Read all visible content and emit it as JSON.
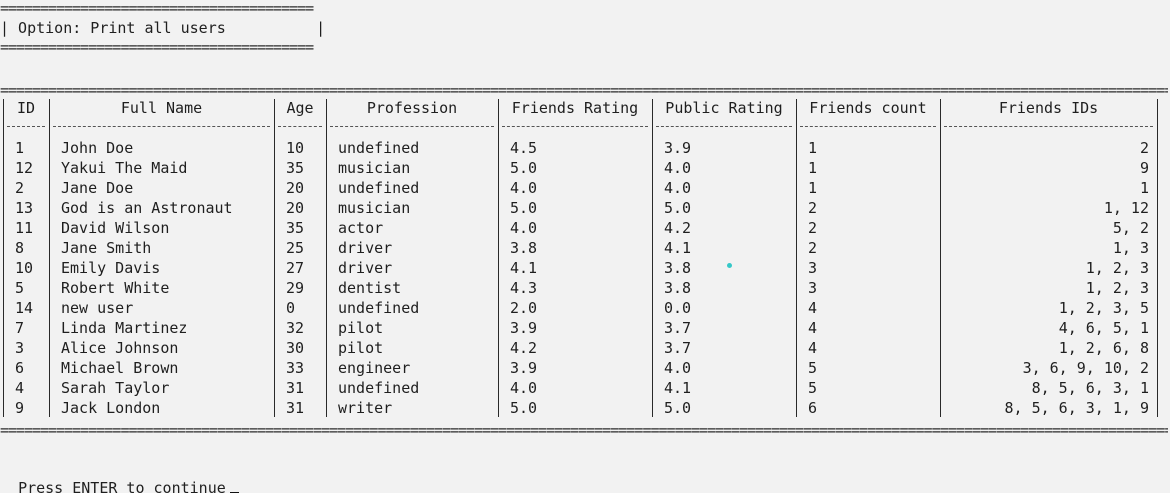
{
  "option_box": {
    "title": "| Option: Print all users          |",
    "rule": "======================================="
  },
  "table": {
    "columns": [
      "ID",
      "Full Name",
      "Age",
      "Profession",
      "Friends Rating",
      "Public Rating",
      "Friends count",
      "Friends IDs"
    ],
    "rows": [
      [
        "1",
        "John Doe",
        "10",
        "undefined",
        "4.5",
        "3.9",
        "1",
        "2"
      ],
      [
        "12",
        "Yakui The Maid",
        "35",
        "musician",
        "5.0",
        "4.0",
        "1",
        "9"
      ],
      [
        "2",
        "Jane Doe",
        "20",
        "undefined",
        "4.0",
        "4.0",
        "1",
        "1"
      ],
      [
        "13",
        "God is an Astronaut",
        "20",
        "musician",
        "5.0",
        "5.0",
        "2",
        "1, 12"
      ],
      [
        "11",
        "David Wilson",
        "35",
        "actor",
        "4.0",
        "4.2",
        "2",
        "5, 2"
      ],
      [
        "8",
        "Jane Smith",
        "25",
        "driver",
        "3.8",
        "4.1",
        "2",
        "1, 3"
      ],
      [
        "10",
        "Emily Davis",
        "27",
        "driver",
        "4.1",
        "3.8",
        "3",
        "1, 2, 3"
      ],
      [
        "5",
        "Robert White",
        "29",
        "dentist",
        "4.3",
        "3.8",
        "3",
        "1, 2, 3"
      ],
      [
        "14",
        "new user",
        "0",
        "undefined",
        "2.0",
        "0.0",
        "4",
        "1, 2, 3, 5"
      ],
      [
        "7",
        "Linda Martinez",
        "32",
        "pilot",
        "3.9",
        "3.7",
        "4",
        "4, 6, 5, 1"
      ],
      [
        "3",
        "Alice Johnson",
        "30",
        "pilot",
        "4.2",
        "3.7",
        "4",
        "1, 2, 6, 8"
      ],
      [
        "6",
        "Michael Brown",
        "33",
        "engineer",
        "3.9",
        "4.0",
        "5",
        "3, 6, 9, 10, 2"
      ],
      [
        "4",
        "Sarah Taylor",
        "31",
        "undefined",
        "4.0",
        "4.1",
        "5",
        "8, 5, 6, 3, 1"
      ],
      [
        "9",
        "Jack London",
        "31",
        "writer",
        "5.0",
        "5.0",
        "6",
        "8, 5, 6, 3, 1, 9"
      ]
    ]
  },
  "prompt": {
    "text": "Press ENTER to continue"
  },
  "colors": {
    "background": "#f2f2f2",
    "text": "#1f1f1f",
    "cursor_dot": "#35c8c8"
  }
}
